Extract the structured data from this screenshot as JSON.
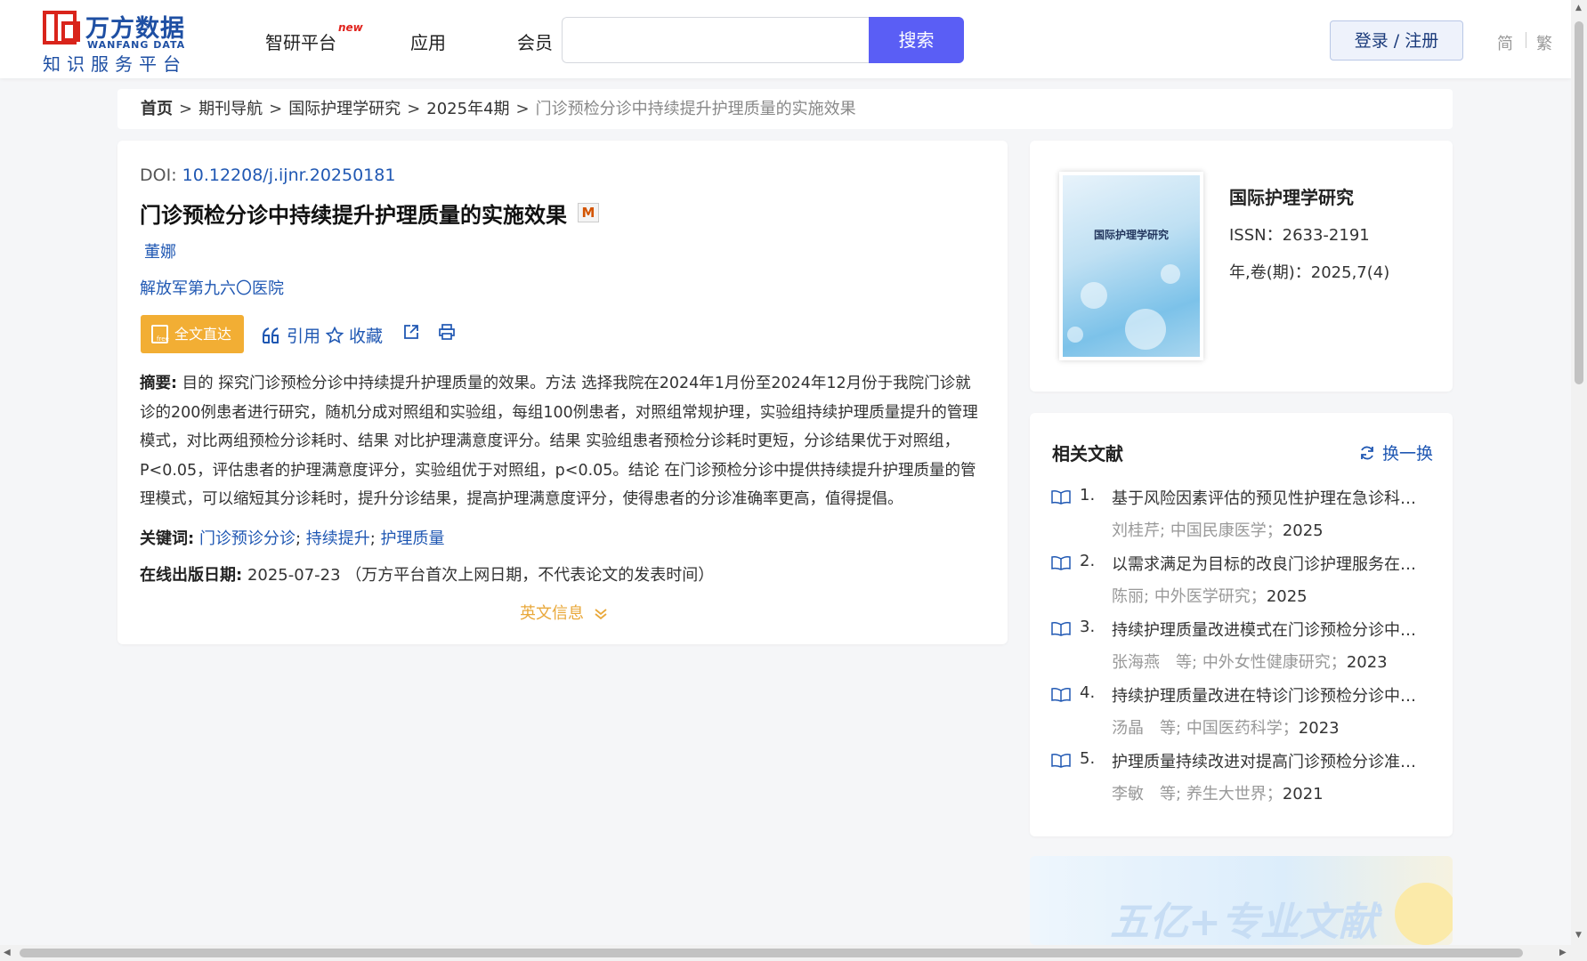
{
  "header": {
    "logo_cn": "万方数据",
    "logo_en": "WANFANG DATA",
    "logo_sub": "知识服务平台",
    "nav": [
      "智研平台",
      "应用",
      "会员"
    ],
    "nav_new_badge": "new",
    "search_placeholder": "",
    "search_button": "搜索",
    "login_button": "登录 / 注册",
    "lang_simplified": "简",
    "lang_traditional": "繁"
  },
  "breadcrumb": {
    "items": [
      "首页",
      "期刊导航",
      "国际护理学研究",
      "2025年4期"
    ],
    "current": "门诊预检分诊中持续提升护理质量的实施效果",
    "separator": ">"
  },
  "article": {
    "doi_label": "DOI:",
    "doi": "10.12208/j.ijnr.20250181",
    "title": "门诊预检分诊中持续提升护理质量的实施效果",
    "title_badge": "M",
    "author": "董娜",
    "organization": "解放军第九六〇医院",
    "fulltext_button": "全文直达",
    "actions": {
      "cite": "引用",
      "favorite": "收藏"
    },
    "abstract_label": "摘要:",
    "abstract": "目的 探究门诊预检分诊中持续提升护理质量的效果。方法 选择我院在2024年1月份至2024年12月份于我院门诊就诊的200例患者进行研究，随机分成对照组和实验组，每组100例患者，对照组常规护理，实验组持续护理质量提升的管理模式，对比两组预检分诊耗时、结果 对比护理满意度评分。结果 实验组患者预检分诊耗时更短，分诊结果优于对照组，P<0.05，评估患者的护理满意度评分，实验组优于对照组，p<0.05。结论 在门诊预检分诊中提供持续提升护理质量的管理模式，可以缩短其分诊耗时，提升分诊结果，提高护理满意度评分，使得患者的分诊准确率更高，值得提倡。",
    "keywords_label": "关键词:",
    "keywords": [
      "门诊预诊分诊",
      "持续提升",
      "护理质量"
    ],
    "pubdate_label": "在线出版日期:",
    "pubdate": "2025-07-23",
    "pubdate_note": "（万方平台首次上网日期，不代表论文的发表时间）",
    "english_info": "英文信息"
  },
  "journal": {
    "cover_title": "国际护理学研究",
    "name": "国际护理学研究",
    "issn": "ISSN：2633-2191",
    "volume": "年,卷(期)：2025,7(4)"
  },
  "related": {
    "title": "相关文献",
    "refresh": "换一换",
    "items": [
      {
        "num": "1.",
        "title": "基于风险因素评估的预见性护理在急诊科门诊预检分诊中的应用",
        "authors": "刘桂芹;",
        "source": "中国民康医学；",
        "year": "2025"
      },
      {
        "num": "2.",
        "title": "以需求满足为目标的改良门诊护理服务在门诊预检分诊中的应用",
        "authors": "陈丽;",
        "source": "中外医学研究；",
        "year": "2025"
      },
      {
        "num": "3.",
        "title": "持续护理质量改进模式在门诊预检分诊中的应用效果",
        "authors": "张海燕　等;",
        "source": "中外女性健康研究；",
        "year": "2023"
      },
      {
        "num": "4.",
        "title": "持续护理质量改进在特诊门诊预检分诊中的应用",
        "authors": "汤晶　等;",
        "source": "中国医药科学；",
        "year": "2023"
      },
      {
        "num": "5.",
        "title": "护理质量持续改进对提高门诊预检分诊准确率的效果",
        "authors": "李敏　等;",
        "source": "养生大世界；",
        "year": "2021"
      }
    ]
  },
  "banner": {
    "text": "五亿+专业文献"
  },
  "colors": {
    "primary": "#5a5ef5",
    "link": "#2058b3",
    "accent": "#f2ae34",
    "logo_red": "#d9241b"
  }
}
